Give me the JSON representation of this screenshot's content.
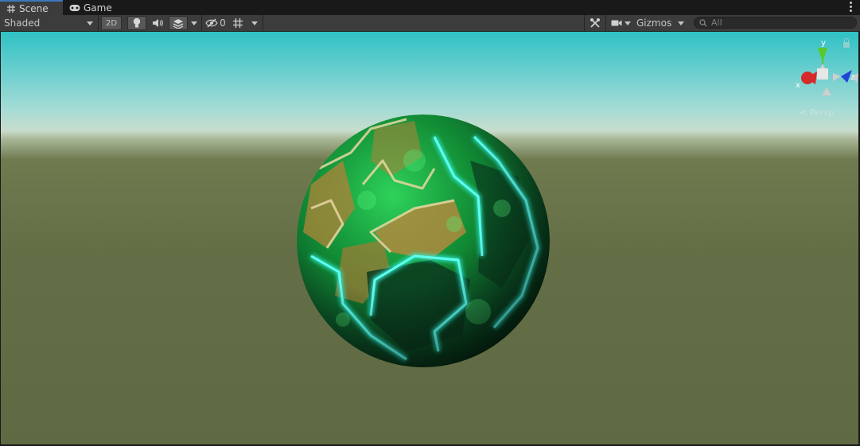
{
  "tabs": [
    {
      "label": "Scene",
      "icon": "scene-grid-icon",
      "active": true
    },
    {
      "label": "Game",
      "icon": "gamepad-icon",
      "active": false
    }
  ],
  "toolbar": {
    "draw_mode": "Shaded",
    "mode_2d": "2D",
    "hidden_count": "0",
    "gizmos_label": "Gizmos",
    "search_placeholder": "All"
  },
  "viewport": {
    "gizmo": {
      "y_label": "y",
      "x_label": "x",
      "z_label": "z"
    },
    "projection_label": "Persp"
  },
  "colors": {
    "accent": "#3a79bb",
    "sky_top": "#2fc1c4",
    "ground": "#646e46",
    "gizmo_x": "#d42a2a",
    "gizmo_y": "#58c92b",
    "gizmo_z": "#2146d4"
  }
}
